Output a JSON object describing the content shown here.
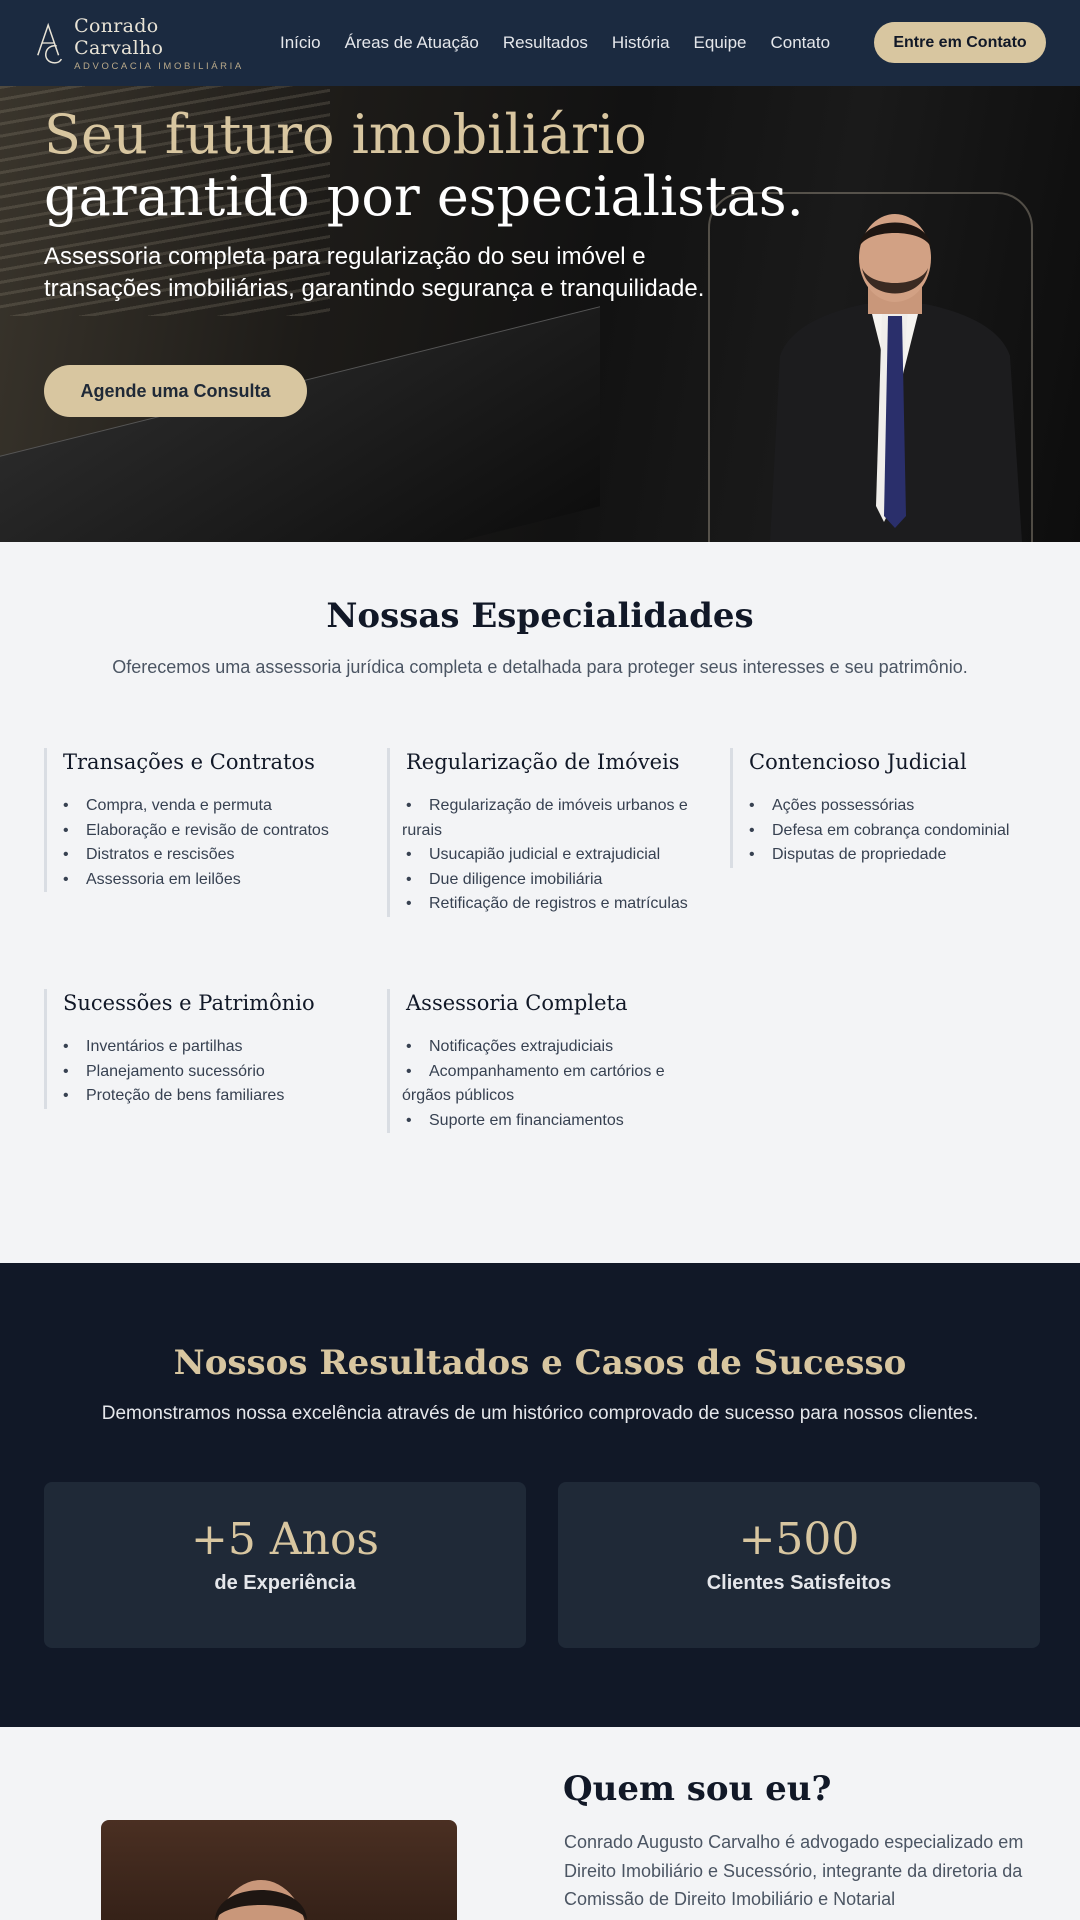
{
  "nav": {
    "logo_name": "Conrado Carvalho",
    "logo_sub": "ADVOCACIA IMOBILIÁRIA",
    "links": [
      "Início",
      "Áreas de Atuação",
      "Resultados",
      "História",
      "Equipe",
      "Contato"
    ],
    "cta": "Entre em Contato"
  },
  "hero": {
    "title_line1": "Seu futuro imobiliário",
    "title_line2": "garantido por especialistas.",
    "subtitle": "Assessoria completa para regularização do seu imóvel e transações imobiliárias, garantindo segurança e tranquilidade.",
    "button": "Agende uma Consulta"
  },
  "specialties": {
    "title": "Nossas Especialidades",
    "description": "Oferecemos uma assessoria jurídica completa e detalhada para proteger seus interesses e seu patrimônio.",
    "cards": [
      {
        "title": "Transações e Contratos",
        "items": [
          "Compra, venda e permuta",
          "Elaboração e revisão de contratos",
          "Distratos e rescisões",
          "Assessoria em leilões"
        ]
      },
      {
        "title": "Regularização de Imóveis",
        "items": [
          "Regularização de imóveis urbanos e rurais",
          "Usucapião judicial e extrajudicial",
          "Due diligence imobiliária",
          "Retificação de registros e matrículas"
        ]
      },
      {
        "title": "Contencioso Judicial",
        "items": [
          "Ações possessórias",
          "Defesa em cobrança condominial",
          "Disputas de propriedade"
        ]
      },
      {
        "title": "Sucessões e Patrimônio",
        "items": [
          "Inventários e partilhas",
          "Planejamento sucessório",
          "Proteção de bens familiares"
        ]
      },
      {
        "title": "Assessoria Completa",
        "items": [
          "Notificações extrajudiciais",
          "Acompanhamento em cartórios e órgãos públicos",
          "Suporte em financiamentos"
        ]
      }
    ]
  },
  "results": {
    "title": "Nossos Resultados e Casos de Sucesso",
    "description": "Demonstramos nossa excelência através de um histórico comprovado de sucesso para nossos clientes.",
    "stats": [
      {
        "number": "+5 Anos",
        "label": "de Experiência"
      },
      {
        "number": "+500",
        "label": "Clientes Satisfeitos"
      }
    ]
  },
  "about": {
    "title": "Quem sou eu?",
    "text": "Conrado Augusto Carvalho é advogado especializado em Direito Imobiliário e Sucessório, integrante da diretoria da Comissão de Direito Imobiliário e Notarial"
  },
  "colors": {
    "navy": "#1b2a40",
    "gold": "#d8c6a0",
    "dark": "#111827",
    "card": "#1f2937",
    "bg": "#f3f4f6"
  }
}
